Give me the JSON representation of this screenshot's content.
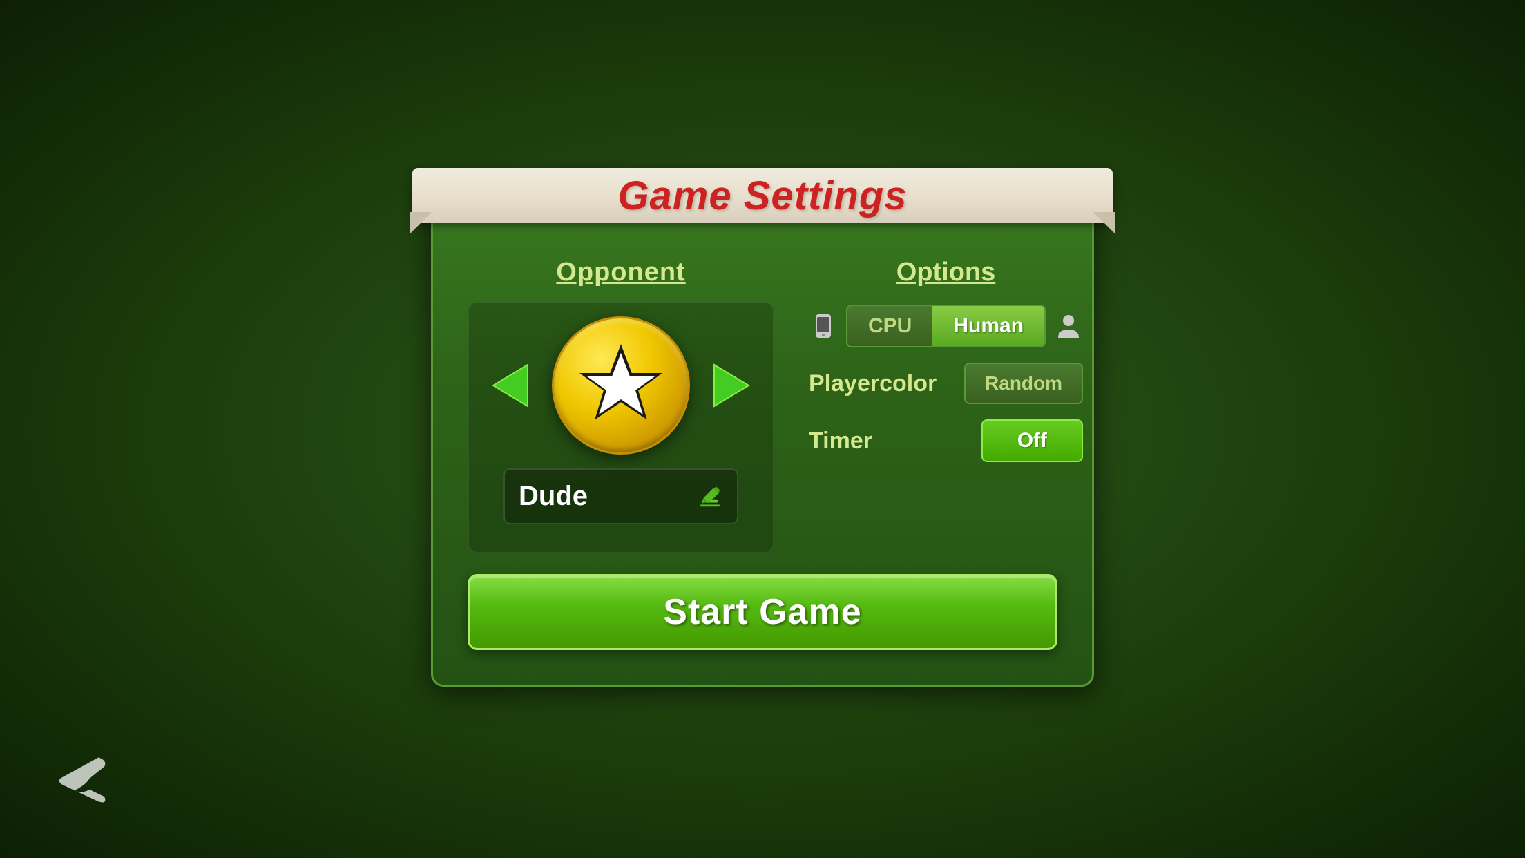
{
  "title": "Game Settings",
  "banner": {
    "title": "Game Settings"
  },
  "opponent": {
    "section_title": "Opponent",
    "player_name": "Dude"
  },
  "options": {
    "section_title": "Options",
    "opponent_type": {
      "cpu_label": "CPU",
      "human_label": "Human",
      "selected": "Human"
    },
    "playercolor": {
      "label": "Playercolor",
      "value_label": "Random"
    },
    "timer": {
      "label": "Timer",
      "value_label": "Off"
    }
  },
  "start_game_button": "Start Game",
  "back_button_label": "Back"
}
